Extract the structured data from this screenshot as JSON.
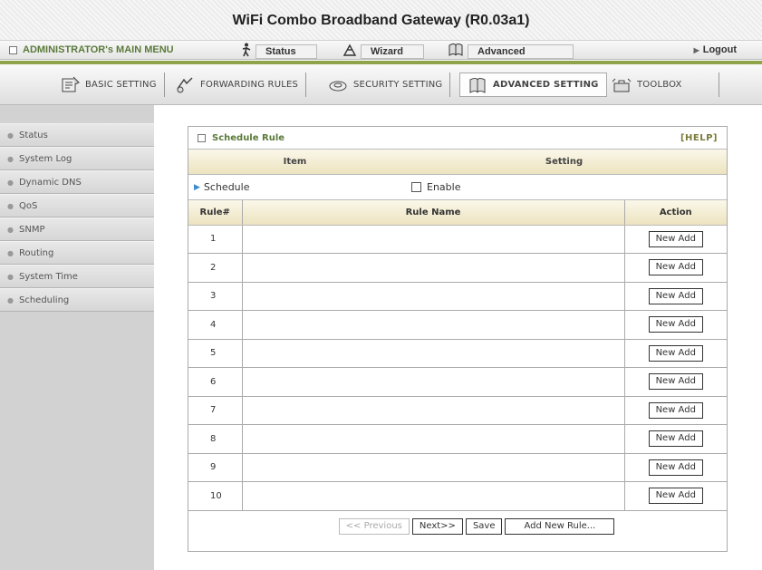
{
  "header": {
    "title": "WiFi Combo Broadband Gateway (R0.03a1)"
  },
  "menu": {
    "admin_label": "ADMINISTRATOR's MAIN MENU",
    "tabs": [
      {
        "label": "Status",
        "icon": "walk-icon"
      },
      {
        "label": "Wizard",
        "icon": "wizard-icon"
      },
      {
        "label": "Advanced",
        "icon": "advanced-icon"
      }
    ],
    "logout_label": "Logout"
  },
  "nav": {
    "items": [
      {
        "label": "BASIC SETTING",
        "icon": "basic-setting-icon"
      },
      {
        "label": "FORWARDING RULES",
        "icon": "forwarding-icon"
      },
      {
        "label": "SECURITY SETTING",
        "icon": "security-icon"
      },
      {
        "label": "ADVANCED SETTING",
        "icon": "advanced-setting-icon",
        "active": true
      },
      {
        "label": "TOOLBOX",
        "icon": "toolbox-icon"
      }
    ]
  },
  "sidebar": {
    "items": [
      {
        "label": "Status"
      },
      {
        "label": "System Log"
      },
      {
        "label": "Dynamic DNS"
      },
      {
        "label": "QoS"
      },
      {
        "label": "SNMP"
      },
      {
        "label": "Routing"
      },
      {
        "label": "System Time"
      },
      {
        "label": "Scheduling"
      }
    ]
  },
  "panel": {
    "title": "Schedule Rule",
    "help": "[HELP]",
    "col_item": "Item",
    "col_setting": "Setting",
    "schedule_label": "Schedule",
    "enable_label": "Enable",
    "enable_checked": false,
    "rules_header": {
      "num": "Rule#",
      "name": "Rule Name",
      "action": "Action"
    },
    "rules": [
      {
        "num": "1",
        "name": "",
        "action": "New Add"
      },
      {
        "num": "2",
        "name": "",
        "action": "New Add"
      },
      {
        "num": "3",
        "name": "",
        "action": "New Add"
      },
      {
        "num": "4",
        "name": "",
        "action": "New Add"
      },
      {
        "num": "5",
        "name": "",
        "action": "New Add"
      },
      {
        "num": "6",
        "name": "",
        "action": "New Add"
      },
      {
        "num": "7",
        "name": "",
        "action": "New Add"
      },
      {
        "num": "8",
        "name": "",
        "action": "New Add"
      },
      {
        "num": "9",
        "name": "",
        "action": "New Add"
      },
      {
        "num": "10",
        "name": "",
        "action": "New Add"
      }
    ],
    "buttons": {
      "previous": "<< Previous",
      "next": "Next>>",
      "save": "Save",
      "add_new": "Add New Rule..."
    }
  },
  "colors": {
    "accent_green": "#8fa34a",
    "header_tan": "#ece3bf",
    "sidebar_gray": "#d2d2d2"
  }
}
